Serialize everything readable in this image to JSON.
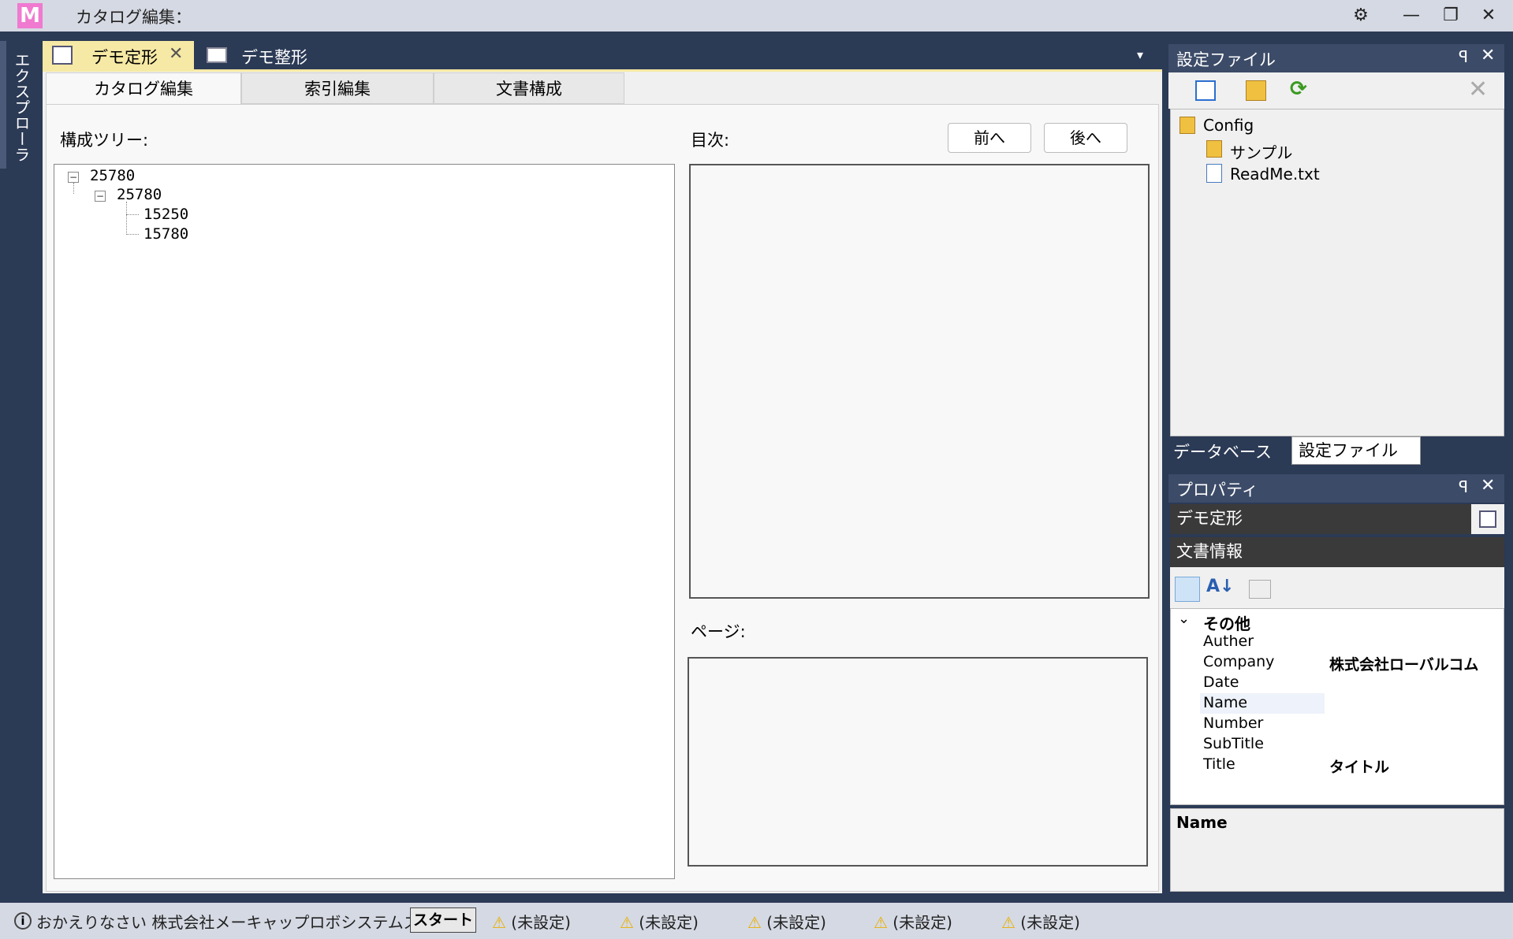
{
  "app": {
    "title": "カタログ編集：",
    "logo": "M"
  },
  "titlebar": {
    "settings_icon": "⚙",
    "minimize": "—",
    "restore": "❐",
    "close": "✕"
  },
  "explorer": {
    "label": "エクスプローラ"
  },
  "doc_tabs": [
    {
      "label": "デモ定形",
      "active": true
    },
    {
      "label": "デモ整形",
      "active": false
    }
  ],
  "doc_tab_dropdown": "▾",
  "sub_tabs": [
    {
      "label": "カタログ編集"
    },
    {
      "label": "索引編集"
    },
    {
      "label": "文書構成"
    }
  ],
  "tree": {
    "label": "構成ツリー:",
    "nodes": [
      "25780",
      "25780",
      "15250",
      "15780"
    ]
  },
  "toc": {
    "label": "目次:",
    "prev": "前へ",
    "next": "後へ"
  },
  "page": {
    "label": "ページ:"
  },
  "config_panel": {
    "title": "設定ファイル",
    "pin": "ꟼ",
    "close": "✕",
    "tree": [
      "Config",
      "サンプル",
      "ReadMe.txt"
    ],
    "tab_db": "データベース",
    "tab_cfg": "設定ファイル"
  },
  "properties": {
    "title": "プロパティ",
    "object": "デモ定形",
    "category_title": "文書情報",
    "group": "その他",
    "rows": [
      {
        "name": "Auther",
        "value": ""
      },
      {
        "name": "Company",
        "value": "株式会社ローバルコム"
      },
      {
        "name": "Date",
        "value": ""
      },
      {
        "name": "Name",
        "value": ""
      },
      {
        "name": "Number",
        "value": ""
      },
      {
        "name": "SubTitle",
        "value": ""
      },
      {
        "name": "Title",
        "value": "タイトル"
      }
    ],
    "desc_name": "Name"
  },
  "status": {
    "info_icon": "i",
    "text": "おかえりなさい 株式会社メーキャップロボシステムズさん",
    "start": "スタート",
    "warnings": [
      "(未設定)",
      "(未設定)",
      "(未設定)",
      "(未設定)",
      "(未設定)"
    ]
  }
}
